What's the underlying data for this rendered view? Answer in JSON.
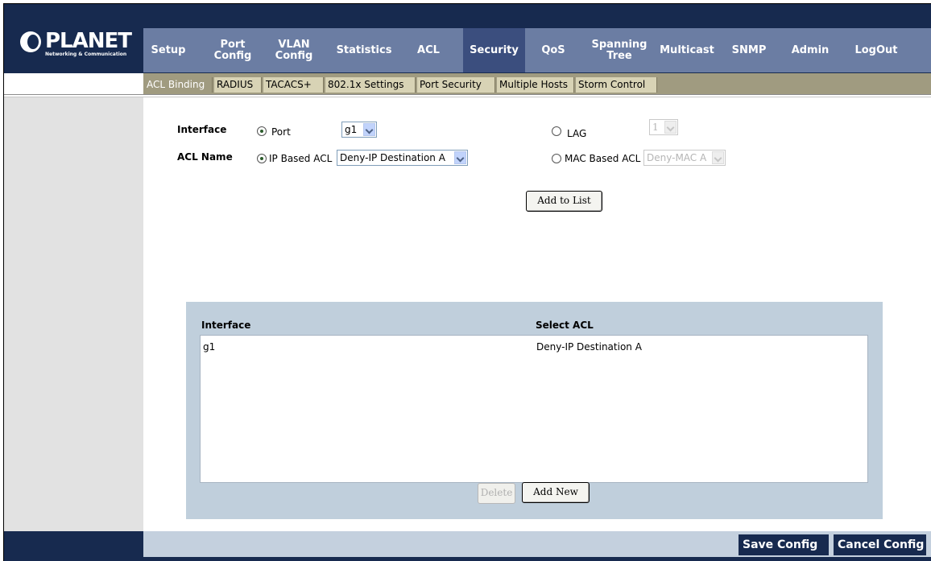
{
  "brand": {
    "name": "PLANET",
    "tagline": "Networking & Communication"
  },
  "nav": {
    "items": [
      {
        "label": "Setup"
      },
      {
        "label": "Port\nConfig"
      },
      {
        "label": "VLAN\nConfig"
      },
      {
        "label": "Statistics"
      },
      {
        "label": "ACL"
      },
      {
        "label": "Security"
      },
      {
        "label": "QoS"
      },
      {
        "label": "Spanning\nTree"
      },
      {
        "label": "Multicast"
      },
      {
        "label": "SNMP"
      },
      {
        "label": "Admin"
      },
      {
        "label": "LogOut"
      }
    ],
    "active": "Security"
  },
  "subnav": {
    "items": [
      {
        "label": "ACL Binding"
      },
      {
        "label": "RADIUS"
      },
      {
        "label": "TACACS+"
      },
      {
        "label": "802.1x Settings"
      },
      {
        "label": "Port Security"
      },
      {
        "label": "Multiple Hosts"
      },
      {
        "label": "Storm Control"
      }
    ],
    "active": "ACL Binding"
  },
  "form": {
    "interface_label": "Interface",
    "port_option": "Port",
    "port_value": "g1",
    "lag_option": "LAG",
    "lag_value": "1",
    "acl_name_label": "ACL Name",
    "ip_acl_option": "IP Based ACL",
    "ip_acl_value": "Deny-IP Destination A",
    "mac_acl_option": "MAC Based ACL",
    "mac_acl_value": "Deny-MAC A",
    "add_to_list": "Add to List"
  },
  "table": {
    "headers": [
      "Interface",
      "Select ACL"
    ],
    "rows": [
      [
        "g1",
        "Deny-IP Destination A"
      ]
    ],
    "delete_label": "Delete",
    "add_new_label": "Add New"
  },
  "footer": {
    "save_label": "Save Config",
    "cancel_label": "Cancel Config"
  },
  "colors": {
    "header": "#172a4f",
    "nav": "#6b7da3",
    "nav_active": "#3b4e7e",
    "subnav": "#a09b80",
    "panel": "#c0cfdc"
  }
}
